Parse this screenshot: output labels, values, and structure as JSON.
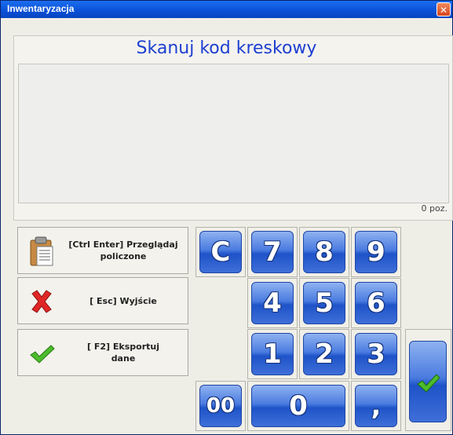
{
  "window": {
    "title": "Inwentaryzacja",
    "close_icon": "close-icon"
  },
  "main": {
    "heading": "Skanuj kod kreskowy",
    "count": "0 poz."
  },
  "actions": [
    {
      "label": "[Ctrl Enter] Przeglądaj\npoliczone",
      "icon": "clipboard-icon"
    },
    {
      "label": "[ Esc] Wyjście",
      "icon": "red-x-icon"
    },
    {
      "label": "[ F2] Eksportuj\ndane",
      "icon": "green-check-icon"
    }
  ],
  "keypad": {
    "clear": "C",
    "k7": "7",
    "k8": "8",
    "k9": "9",
    "k4": "4",
    "k5": "5",
    "k6": "6",
    "k1": "1",
    "k2": "2",
    "k3": "3",
    "k00": "00",
    "k0": "0",
    "comma": ",",
    "ok_icon": "check-icon"
  },
  "colors": {
    "accent": "#1d3fd1",
    "titlebar": "#0a50d6",
    "key": "#3f6fd8"
  }
}
